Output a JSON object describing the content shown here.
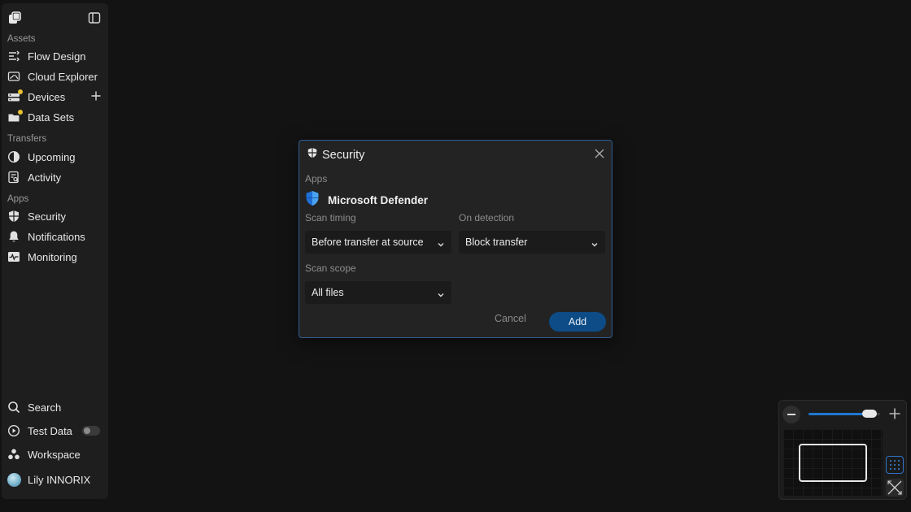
{
  "sidebar": {
    "sections": {
      "assets": "Assets",
      "transfers": "Transfers",
      "apps": "Apps"
    },
    "assets_items": [
      {
        "label": "Flow Design",
        "icon": "flow-icon"
      },
      {
        "label": "Cloud Explorer",
        "icon": "cloud-explorer-icon"
      },
      {
        "label": "Devices",
        "icon": "devices-icon"
      },
      {
        "label": "Data Sets",
        "icon": "datasets-icon"
      }
    ],
    "transfers_items": [
      {
        "label": "Upcoming",
        "icon": "upcoming-icon"
      },
      {
        "label": "Activity",
        "icon": "activity-icon"
      }
    ],
    "apps_items": [
      {
        "label": "Security",
        "icon": "shield-icon"
      },
      {
        "label": "Notifications",
        "icon": "bell-icon"
      },
      {
        "label": "Monitoring",
        "icon": "monitoring-icon"
      }
    ],
    "bottom_items": [
      {
        "label": "Search",
        "icon": "search-icon"
      },
      {
        "label": "Test Data",
        "icon": "play-icon"
      },
      {
        "label": "Workspace",
        "icon": "workspace-icon"
      },
      {
        "label": "Lily INNORIX",
        "icon": "avatar"
      }
    ],
    "test_data_enabled": false,
    "badge_color": "#e8c230"
  },
  "dialog": {
    "title": "Security",
    "apps_label": "Apps",
    "app_name": "Microsoft Defender",
    "scan_timing_label": "Scan timing",
    "scan_timing_value": "Before transfer at source",
    "on_detection_label": "On detection",
    "on_detection_value": "Block transfer",
    "scan_scope_label": "Scan scope",
    "scan_scope_value": "All files",
    "cancel_label": "Cancel",
    "add_label": "Add",
    "accent_color": "#0d4c86",
    "border_color": "#2f5f93"
  },
  "zoom": {
    "level": 0.85,
    "slider_color": "#1f78d1"
  }
}
